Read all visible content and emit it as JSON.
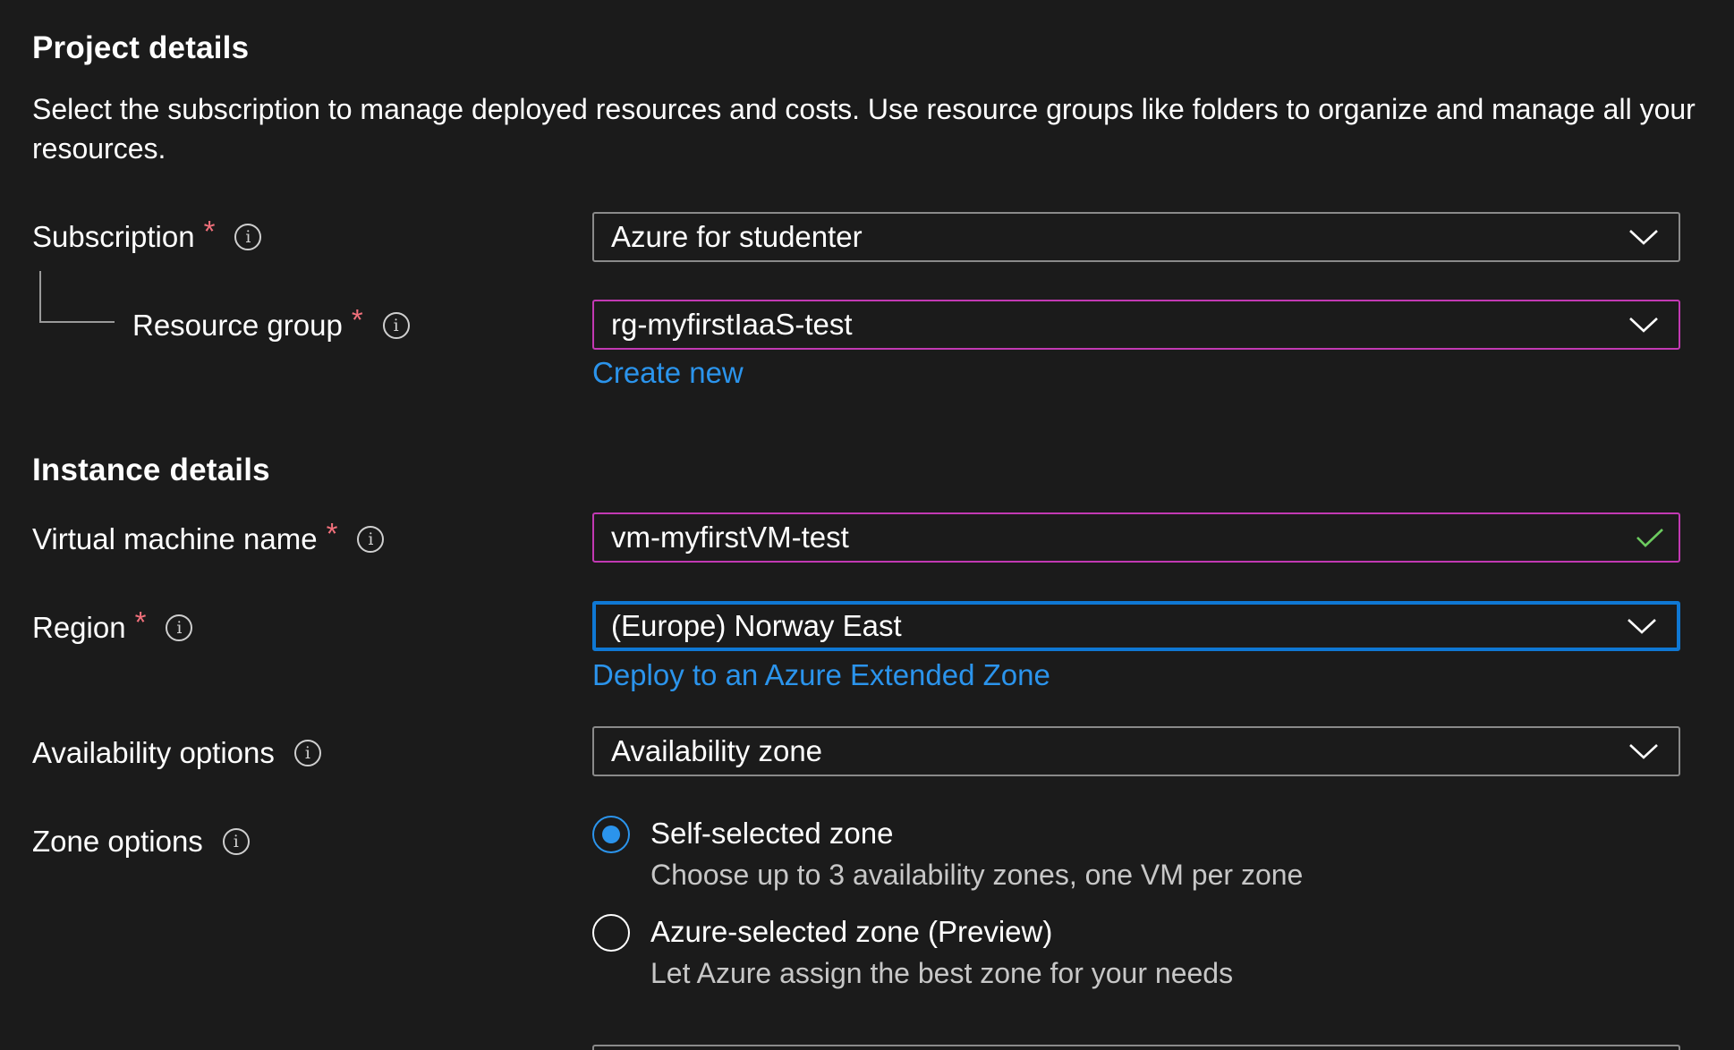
{
  "project_details": {
    "heading": "Project details",
    "description": "Select the subscription to manage deployed resources and costs. Use resource groups like folders to organize and manage all your resources."
  },
  "subscription": {
    "label": "Subscription",
    "required_mark": "*",
    "value": "Azure for studenter"
  },
  "resource_group": {
    "label": "Resource group",
    "required_mark": "*",
    "value": "rg-myfirstIaaS-test",
    "create_new_link": "Create new"
  },
  "instance_details": {
    "heading": "Instance details"
  },
  "vm_name": {
    "label": "Virtual machine name",
    "required_mark": "*",
    "value": "vm-myfirstVM-test"
  },
  "region": {
    "label": "Region",
    "required_mark": "*",
    "value": "(Europe) Norway East",
    "extended_zone_link": "Deploy to an Azure Extended Zone"
  },
  "availability": {
    "label": "Availability options",
    "value": "Availability zone"
  },
  "zone_options": {
    "label": "Zone options",
    "options": [
      {
        "label": "Self-selected zone",
        "description": "Choose up to 3 availability zones, one VM per zone",
        "selected": true
      },
      {
        "label": "Azure-selected zone (Preview)",
        "description": "Let Azure assign the best zone for your needs",
        "selected": false
      }
    ]
  },
  "info_icon_glyph": "i",
  "icons": [
    "info-icon",
    "chevron-down-icon",
    "checkmark-icon"
  ],
  "colors": {
    "background": "#1b1b1b",
    "text": "#ffffff",
    "secondary_text": "#c7c7c7",
    "required": "#f1707b",
    "link": "#2b94ec",
    "focus_border": "#0f78d4",
    "validated_border": "#c239b3",
    "valid_check": "#6ccb5f",
    "default_border": "#8a8a8a"
  }
}
